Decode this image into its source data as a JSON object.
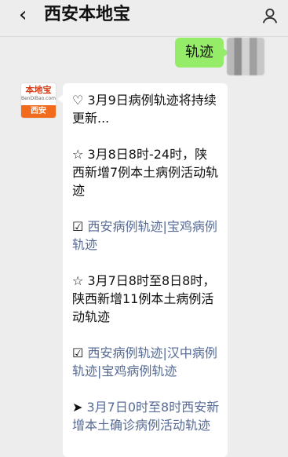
{
  "header": {
    "back_icon": "chevron-left-icon",
    "title": "西安本地宝",
    "profile_icon": "person-icon"
  },
  "chat": {
    "outgoing_message": "轨迹",
    "incoming_avatar_logo_text": "本地宝",
    "incoming_avatar_logo_subtext": "BenDiBao.com",
    "incoming_avatar_city": "西安",
    "incoming_message": {
      "line1_symbol": "♡",
      "line1_text": "3月9日病例轨迹将持续更新...",
      "line2_symbol": "☆",
      "line2_text": "3月8日8时-24时，陕西新增7例本土病例活动轨迹",
      "line3_symbol": "☑",
      "line3_link1": "西安病例轨迹",
      "line3_sep1": "|",
      "line3_link2": "宝鸡病例轨迹",
      "line4_symbol": "☆",
      "line4_text": "3月7日8时至8日8时，陕西新增11例本土病例活动轨迹",
      "line5_symbol": "☑",
      "line5_link1": "西安病例轨迹",
      "line5_sep1": "|",
      "line5_link2": "汉中病例轨迹",
      "line5_sep2": "|",
      "line5_link3": "宝鸡病例轨迹",
      "line6_symbol": "➤",
      "line6_text": "3月7日0时至8时西安新增本土确诊病例活动轨迹"
    }
  }
}
